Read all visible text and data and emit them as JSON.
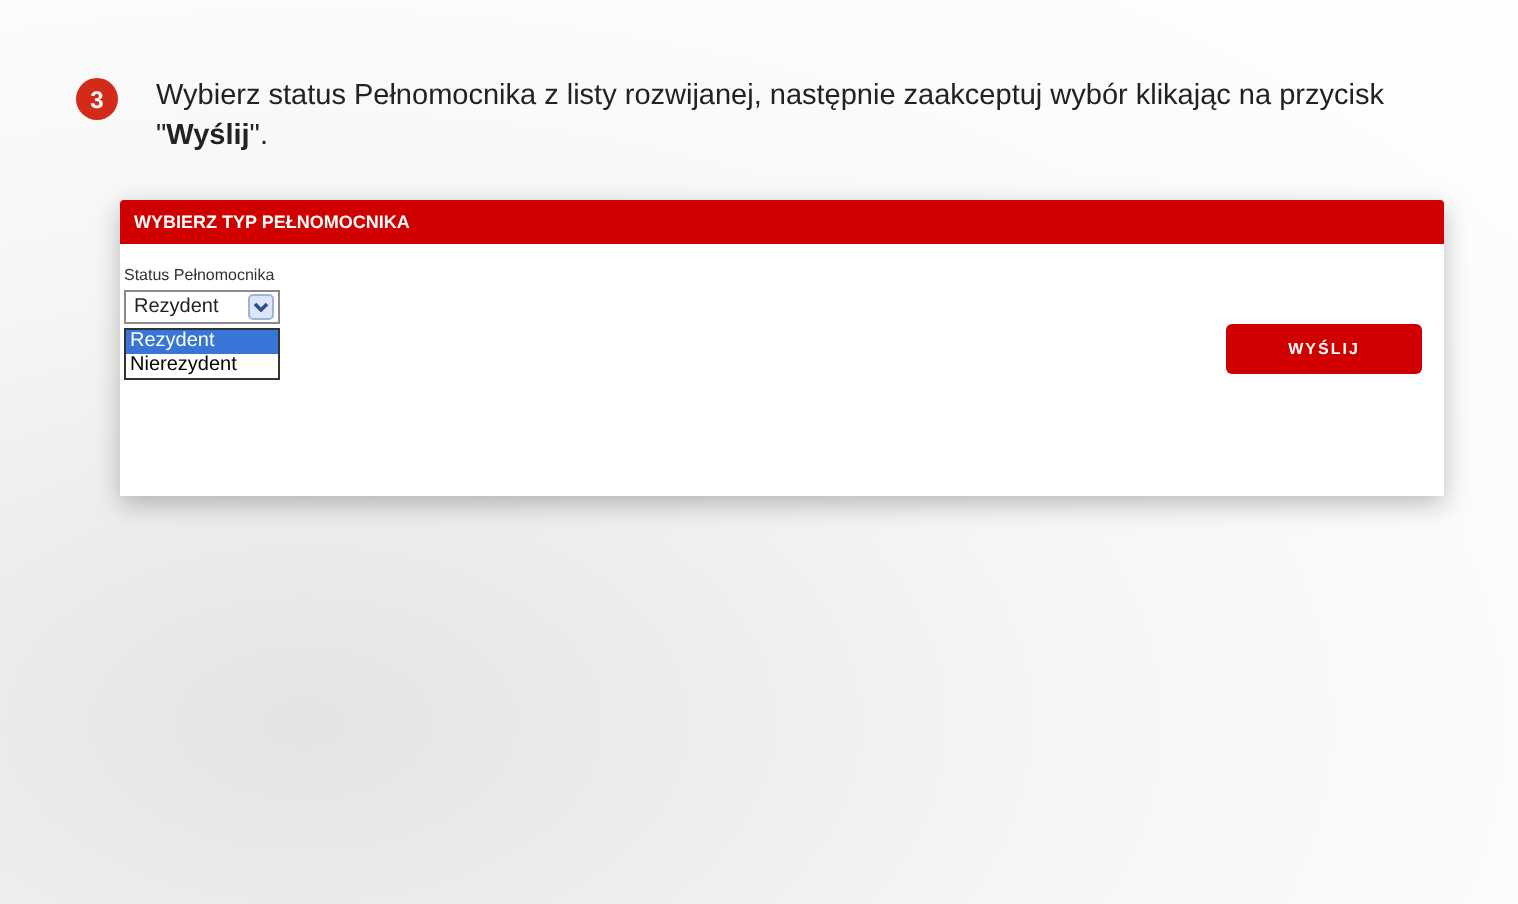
{
  "step": {
    "number": "3",
    "instruction": "Wybierz status Pełnomocnika z listy rozwijanej, następnie zaakceptuj wybór klikając na przycisk \"**Wyślij**\"."
  },
  "panel": {
    "title": "WYBIERZ TYP PEŁNOMOCNIKA",
    "field_label": "Status Pełnomocnika",
    "select_value": "Rezydent",
    "expanded": true,
    "options": [
      {
        "label": "Rezydent",
        "selected": true
      },
      {
        "label": "Nierezydent",
        "selected": false
      }
    ],
    "button": "WYŚLIJ"
  }
}
